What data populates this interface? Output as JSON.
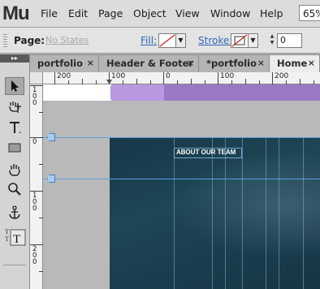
{
  "app": {
    "logo": "Mu"
  },
  "menubar": {
    "items": [
      "File",
      "Edit",
      "Page",
      "Object",
      "View",
      "Window",
      "Help"
    ],
    "zoom": "65%"
  },
  "controlbar": {
    "page_label": "Page:",
    "page_value": "No States",
    "fill_label": "Fill:",
    "stroke_label": "Stroke:",
    "stroke_width": "0"
  },
  "tabs": [
    {
      "label": "portfolio",
      "close": "×",
      "active": false
    },
    {
      "label": "Header & Footer",
      "close": "×",
      "active": false
    },
    {
      "label": "*portfolio",
      "close": "×",
      "active": false
    },
    {
      "label": "Home",
      "close": "×",
      "active": true
    }
  ],
  "rulers": {
    "top_labels": [
      "200",
      "100",
      "0",
      "100",
      "200"
    ],
    "left_labels": [
      [
        "1",
        "0",
        "0"
      ],
      [
        "0"
      ],
      [
        "1",
        "0",
        "0"
      ],
      [
        "2",
        "0",
        "0"
      ]
    ]
  },
  "tools": [
    "selection-tool",
    "crop-tool",
    "text-tool",
    "rectangle-tool",
    "hand-tool",
    "zoom-tool",
    "anchor-tool",
    "text-frame-tool"
  ],
  "canvas": {
    "heading": "ABOUT OUR TEAM"
  },
  "colors": {
    "menubar_bg": "#dcdcdc",
    "link_blue": "#3066b8",
    "guide_blue": "#5f9fe0",
    "purple_light": "#b998e0",
    "purple_dark": "#9a78c4",
    "hero_teal": "#1e4656"
  }
}
